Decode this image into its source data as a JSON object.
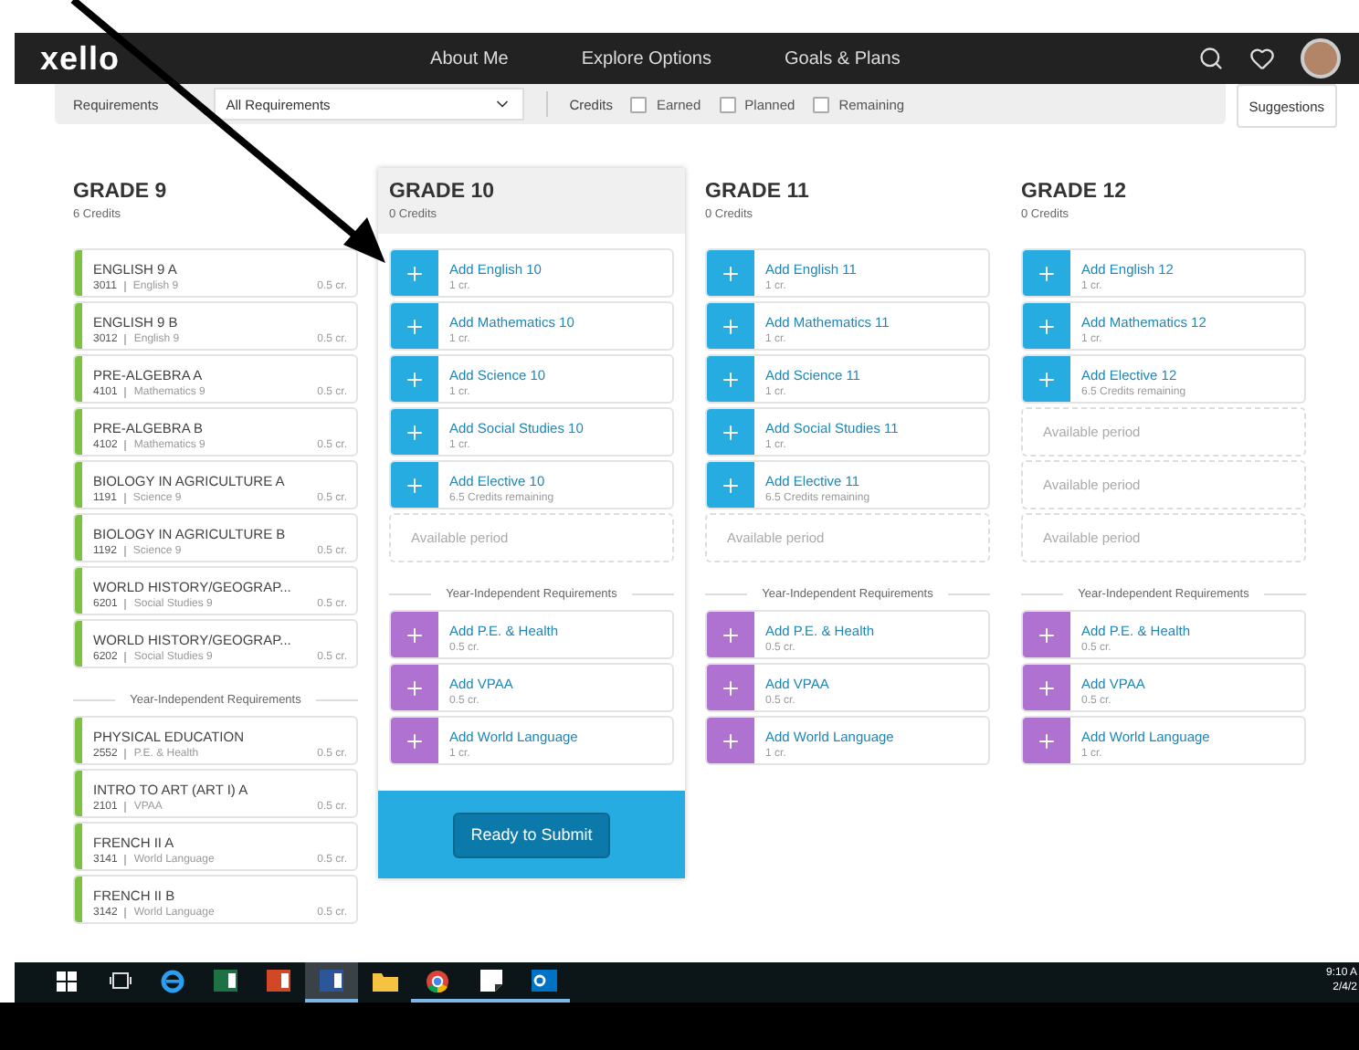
{
  "header": {
    "logo": "xello",
    "nav": [
      {
        "label": "About Me",
        "selected": false
      },
      {
        "label": "Explore Options",
        "selected": false
      },
      {
        "label": "Goals & Plans",
        "selected": false
      }
    ]
  },
  "filters": {
    "requirements_label": "Requirements",
    "requirements_value": "All Requirements",
    "credits_label": "Credits",
    "checkboxes": [
      {
        "label": "Earned",
        "checked": false
      },
      {
        "label": "Planned",
        "checked": false
      },
      {
        "label": "Remaining",
        "checked": false
      }
    ],
    "suggestions_button": "Suggestions"
  },
  "grades": [
    {
      "title": "GRADE 9",
      "credits": "6 Credits",
      "selected": false,
      "courses": [
        {
          "kind": "course",
          "color": "#7dc142",
          "name": "ENGLISH 9 A",
          "code": "3011",
          "subject": "English 9",
          "credits": "0.5 cr."
        },
        {
          "kind": "course",
          "color": "#7dc142",
          "name": "ENGLISH 9 B",
          "code": "3012",
          "subject": "English 9",
          "credits": "0.5 cr."
        },
        {
          "kind": "course",
          "color": "#7dc142",
          "name": "PRE-ALGEBRA A",
          "code": "4101",
          "subject": "Mathematics 9",
          "credits": "0.5 cr."
        },
        {
          "kind": "course",
          "color": "#7dc142",
          "name": "PRE-ALGEBRA B",
          "code": "4102",
          "subject": "Mathematics 9",
          "credits": "0.5 cr."
        },
        {
          "kind": "course",
          "color": "#7dc142",
          "name": "BIOLOGY IN AGRICULTURE A",
          "code": "1191",
          "subject": "Science 9",
          "credits": "0.5 cr."
        },
        {
          "kind": "course",
          "color": "#7dc142",
          "name": "BIOLOGY IN AGRICULTURE B",
          "code": "1192",
          "subject": "Science 9",
          "credits": "0.5 cr."
        },
        {
          "kind": "course",
          "color": "#7dc142",
          "name": "WORLD HISTORY/GEOGRAP...",
          "code": "6201",
          "subject": "Social Studies 9",
          "credits": "0.5 cr."
        },
        {
          "kind": "course",
          "color": "#7dc142",
          "name": "WORLD HISTORY/GEOGRAP...",
          "code": "6202",
          "subject": "Social Studies 9",
          "credits": "0.5 cr."
        }
      ],
      "independent_heading": "Year-Independent Requirements",
      "independent": [
        {
          "kind": "course",
          "color": "#7dc142",
          "name": "PHYSICAL EDUCATION",
          "code": "2552",
          "subject": "P.E. & Health",
          "credits": "0.5 cr."
        },
        {
          "kind": "course",
          "color": "#7dc142",
          "name": "INTRO TO ART (ART I) A",
          "code": "2101",
          "subject": "VPAA",
          "credits": "0.5 cr."
        },
        {
          "kind": "course",
          "color": "#7dc142",
          "name": "FRENCH II A",
          "code": "3141",
          "subject": "World Language",
          "credits": "0.5 cr."
        },
        {
          "kind": "course",
          "color": "#7dc142",
          "name": "FRENCH II B",
          "code": "3142",
          "subject": "World Language",
          "credits": "0.5 cr."
        }
      ]
    },
    {
      "title": "GRADE 10",
      "credits": "0 Credits",
      "selected": true,
      "courses": [
        {
          "kind": "add",
          "color": "#26ace0",
          "name": "Add English 10",
          "detail": "1 cr."
        },
        {
          "kind": "add",
          "color": "#26ace0",
          "name": "Add Mathematics 10",
          "detail": "1 cr."
        },
        {
          "kind": "add",
          "color": "#26ace0",
          "name": "Add Science 10",
          "detail": "1 cr."
        },
        {
          "kind": "add",
          "color": "#26ace0",
          "name": "Add Social Studies 10",
          "detail": "1 cr."
        },
        {
          "kind": "add",
          "color": "#26ace0",
          "name": "Add Elective 10",
          "detail": "6.5 Credits remaining"
        },
        {
          "kind": "empty",
          "name": "Available period"
        }
      ],
      "independent_heading": "Year-Independent Requirements",
      "independent": [
        {
          "kind": "add",
          "color": "#b072d0",
          "name": "Add P.E. & Health",
          "detail": "0.5 cr."
        },
        {
          "kind": "add",
          "color": "#b072d0",
          "name": "Add VPAA",
          "detail": "0.5 cr."
        },
        {
          "kind": "add",
          "color": "#b072d0",
          "name": "Add World Language",
          "detail": "1 cr."
        }
      ],
      "submit_button": "Ready to Submit"
    },
    {
      "title": "GRADE 11",
      "credits": "0 Credits",
      "selected": false,
      "courses": [
        {
          "kind": "add",
          "color": "#26ace0",
          "name": "Add English 11",
          "detail": "1 cr."
        },
        {
          "kind": "add",
          "color": "#26ace0",
          "name": "Add Mathematics 11",
          "detail": "1 cr."
        },
        {
          "kind": "add",
          "color": "#26ace0",
          "name": "Add Science 11",
          "detail": "1 cr."
        },
        {
          "kind": "add",
          "color": "#26ace0",
          "name": "Add Social Studies 11",
          "detail": "1 cr."
        },
        {
          "kind": "add",
          "color": "#26ace0",
          "name": "Add Elective 11",
          "detail": "6.5 Credits remaining"
        },
        {
          "kind": "empty",
          "name": "Available period"
        }
      ],
      "independent_heading": "Year-Independent Requirements",
      "independent": [
        {
          "kind": "add",
          "color": "#b072d0",
          "name": "Add P.E. & Health",
          "detail": "0.5 cr."
        },
        {
          "kind": "add",
          "color": "#b072d0",
          "name": "Add VPAA",
          "detail": "0.5 cr."
        },
        {
          "kind": "add",
          "color": "#b072d0",
          "name": "Add World Language",
          "detail": "1 cr."
        }
      ]
    },
    {
      "title": "GRADE 12",
      "credits": "0 Credits",
      "selected": false,
      "courses": [
        {
          "kind": "add",
          "color": "#26ace0",
          "name": "Add English 12",
          "detail": "1 cr."
        },
        {
          "kind": "add",
          "color": "#26ace0",
          "name": "Add Mathematics 12",
          "detail": "1 cr."
        },
        {
          "kind": "add",
          "color": "#26ace0",
          "name": "Add Elective 12",
          "detail": "6.5 Credits remaining"
        },
        {
          "kind": "empty",
          "name": "Available period"
        },
        {
          "kind": "empty",
          "name": "Available period"
        },
        {
          "kind": "empty",
          "name": "Available period"
        }
      ],
      "independent_heading": "Year-Independent Requirements",
      "independent": [
        {
          "kind": "add",
          "color": "#b072d0",
          "name": "Add P.E. & Health",
          "detail": "0.5 cr."
        },
        {
          "kind": "add",
          "color": "#b072d0",
          "name": "Add VPAA",
          "detail": "0.5 cr."
        },
        {
          "kind": "add",
          "color": "#b072d0",
          "name": "Add World Language",
          "detail": "1 cr."
        }
      ]
    }
  ],
  "taskbar": {
    "apps": [
      {
        "kind": "task-view",
        "selected": false,
        "running": false
      },
      {
        "kind": "ie",
        "selected": false,
        "running": false
      },
      {
        "kind": "excel",
        "selected": false,
        "running": false
      },
      {
        "kind": "powerpoint",
        "selected": false,
        "running": false
      },
      {
        "kind": "word",
        "selected": true,
        "running": true
      },
      {
        "kind": "folder",
        "selected": false,
        "running": false
      },
      {
        "kind": "chrome",
        "selected": false,
        "running": true
      },
      {
        "kind": "notes",
        "selected": false,
        "running": true
      },
      {
        "kind": "outlook",
        "selected": false,
        "running": true
      }
    ],
    "time": "9:10 A",
    "date": "2/4/2"
  }
}
